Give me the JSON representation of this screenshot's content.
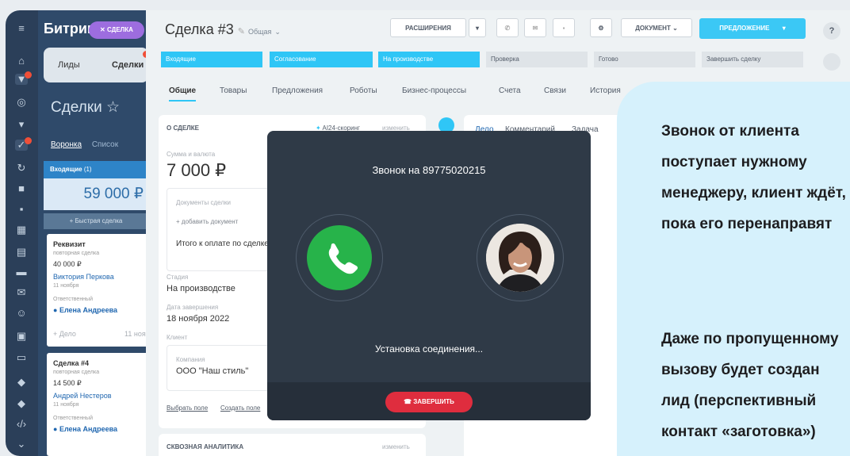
{
  "app": {
    "logo": "Битрикс",
    "pill": "СДЕЛКА"
  },
  "left_tabs": {
    "leads": "Лиды",
    "deals": "Сделки"
  },
  "left_heading": "Сделки ☆",
  "view_links": {
    "funnel": "Воронка",
    "list": "Список"
  },
  "left_stage": {
    "name": "Входящие",
    "count": "(1)"
  },
  "left_total": "59 000 ₽",
  "quick_deal": "+ Быстрая сделка",
  "cards": [
    {
      "title": "Реквизит",
      "sub": "повторная сделка",
      "sum": "40 000 ₽",
      "contact": "Виктория Перкова",
      "date": "11 ноября",
      "resp_label": "Ответственный",
      "resp": "Елена Андреева"
    },
    {
      "title": "Сделка #4",
      "sub": "повторная сделка",
      "sum": "14 500 ₽",
      "contact": "Андрей Нестеров",
      "date": "11 ноября",
      "resp_label": "Ответственный",
      "resp": "Елена Андреева"
    }
  ],
  "card_footer": {
    "add": "+ Дело",
    "date": "11 ноя"
  },
  "deal": {
    "title": "Сделка #3",
    "category": "Общая"
  },
  "toolbar": {
    "ext": "РАСШИРЕНИЯ",
    "doc": "ДОКУМЕНТ",
    "offer": "ПРЕДЛОЖЕНИЕ",
    "help": "?"
  },
  "stages": [
    "Входящие",
    "Согласование",
    "На производстве",
    "Проверка",
    "Готово",
    "Завершить сделку"
  ],
  "tabs": [
    "Общие",
    "Товары",
    "Предложения",
    "Роботы",
    "Бизнес-процессы",
    "Счета",
    "Связи",
    "История"
  ],
  "about": {
    "header": "О СДЕЛКЕ",
    "scoring": "AI24-скоринг",
    "edit": "изменить",
    "sum_label": "Сумма и валюта",
    "sum": "7 000 ₽",
    "docs_label": "Документы сделки",
    "add_doc": "+ добавить документ",
    "total_pay": "Итого к оплате по сделке",
    "stage_label": "Стадия",
    "stage": "На производстве",
    "close_label": "Дата завершения",
    "close": "18 ноября 2022",
    "client_label": "Клиент",
    "company_label": "Компания",
    "company": "ООО \"Наш стиль\"",
    "choose_field": "Выбрать поле",
    "create_field": "Создать поле"
  },
  "analytics": {
    "header": "СКВОЗНАЯ АНАЛИТИКА",
    "edit": "изменить"
  },
  "activity_tabs": [
    "Дело",
    "Комментарий",
    "Задача"
  ],
  "call": {
    "title": "Звонок на 89775020215",
    "status": "Установка соединения...",
    "end": "ЗАВЕРШИТЬ"
  },
  "callout": {
    "p1": "Звонок от клиента\nпоступает нужному\nменеджеру, клиент ждёт,\nпока его перенаправят",
    "p2": "Даже по пропущенному\nвызову будет создан\nлид (перспективный\nконтакт «заготовка»)"
  },
  "colors": {
    "stage_blue": "#2fc6f6",
    "offer": "#3bc8f5",
    "call_green": "#27b34a",
    "end_red": "#df2d3e",
    "callout_bg": "#d6f1fc"
  }
}
